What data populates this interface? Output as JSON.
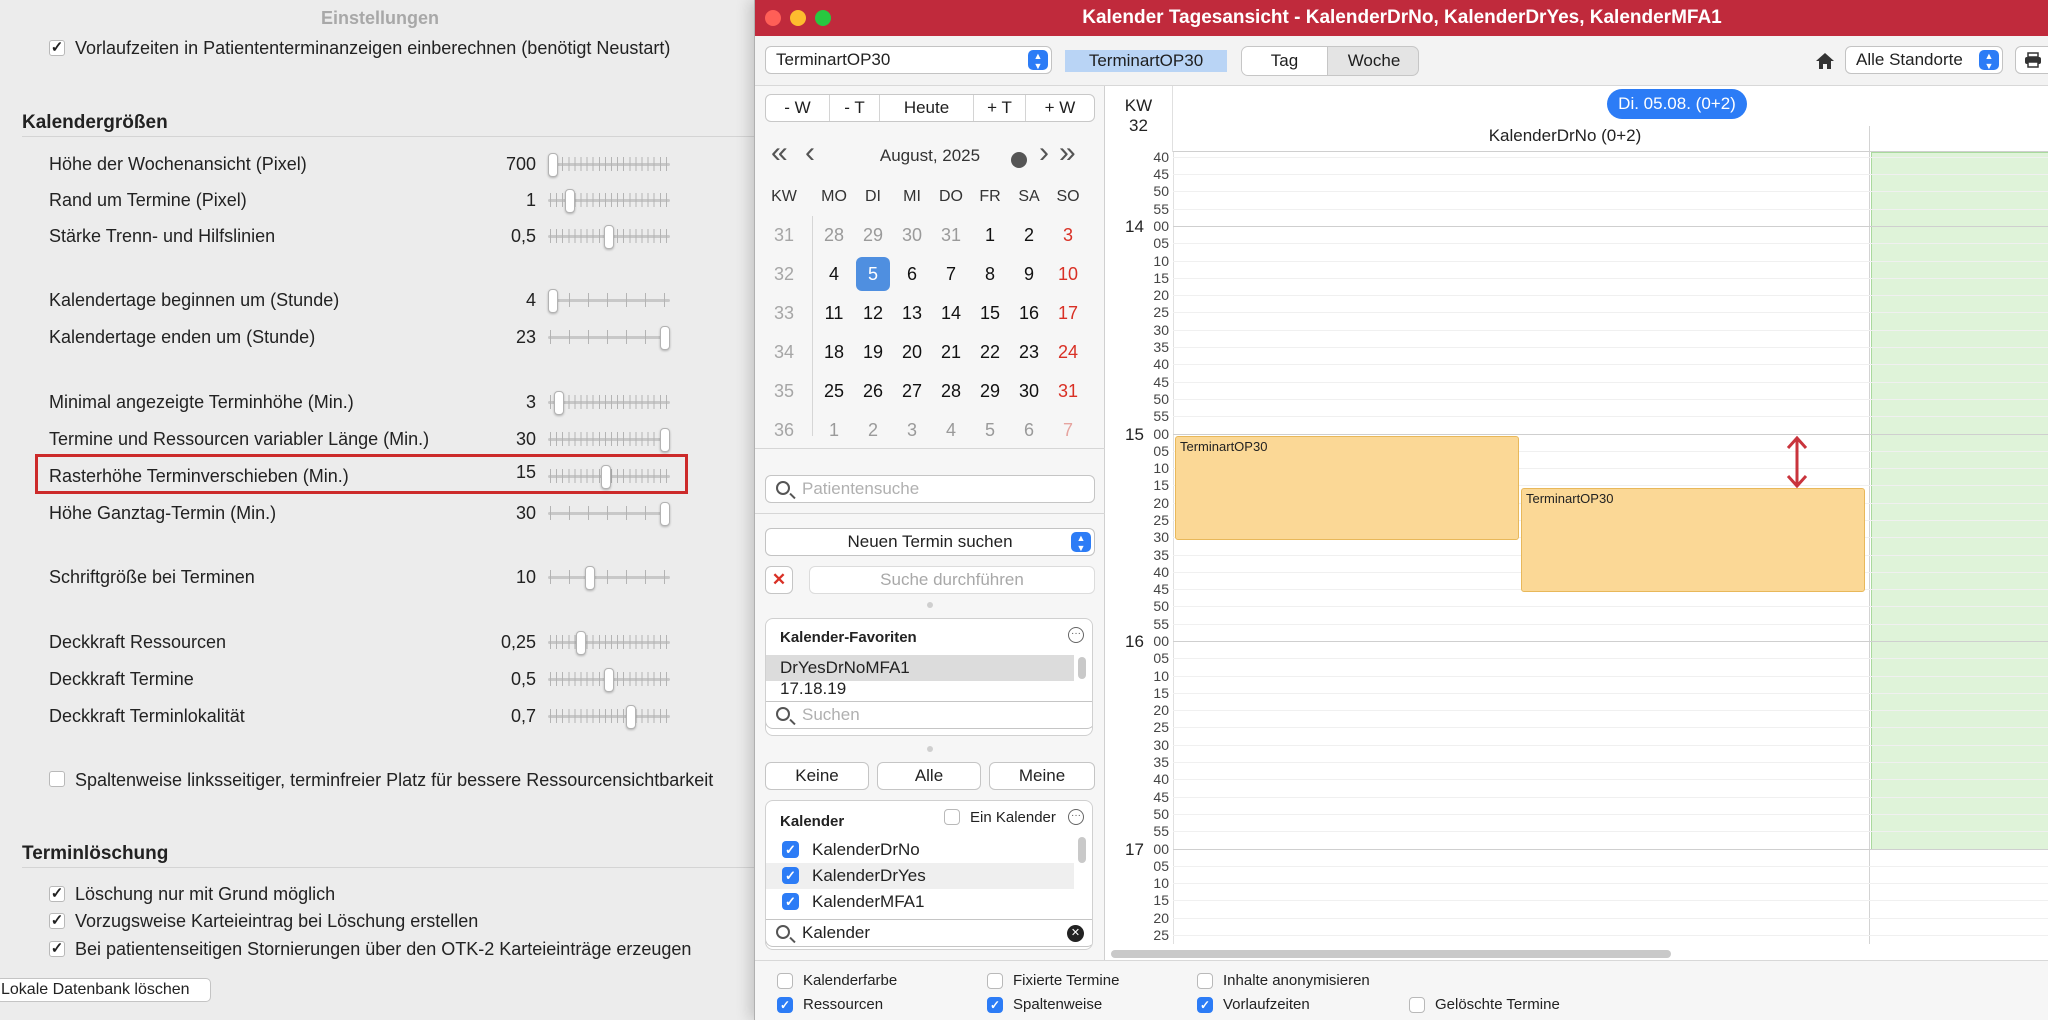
{
  "settings": {
    "window_title": "Einstellungen",
    "vorlauf_label": "Vorlaufzeiten in Patiententerminanzeigen einberechnen (benötigt Neustart)",
    "section_size": "Kalendergrößen",
    "section_delete": "Terminlöschung",
    "sliders": [
      {
        "label": "Höhe der Wochenansicht (Pixel)",
        "value": "700",
        "level": 0.0
      },
      {
        "label": "Rand um Termine (Pixel)",
        "value": "1",
        "level": 0.15
      },
      {
        "label": "Stärke Trenn- und Hilfslinien",
        "value": "0,5",
        "level": 0.5
      },
      {
        "label": "Kalendertage beginnen um (Stunde)",
        "value": "4",
        "level": 0.0
      },
      {
        "label": "Kalendertage enden um (Stunde)",
        "value": "23",
        "level": 1.0
      },
      {
        "label": "Minimal angezeigte Terminhöhe (Min.)",
        "value": "3",
        "level": 0.05
      },
      {
        "label": "Termine und Ressourcen variabler Länge (Min.)",
        "value": "30",
        "level": 1.0
      },
      {
        "label": "Rasterhöhe Terminverschieben (Min.)",
        "value": "15",
        "level": 0.47
      },
      {
        "label": "Höhe Ganztag-Termin (Min.)",
        "value": "30",
        "level": 1.0
      },
      {
        "label": "Schriftgröße bei Terminen",
        "value": "10",
        "level": 0.33
      },
      {
        "label": "Deckkraft Ressourcen",
        "value": "0,25",
        "level": 0.25
      },
      {
        "label": "Deckkraft Termine",
        "value": "0,5",
        "level": 0.5
      },
      {
        "label": "Deckkraft Terminlokalität",
        "value": "0,7",
        "level": 0.7
      }
    ],
    "spalten_label": "Spaltenweise linksseitiger, terminfreier Platz für bessere Ressourcensichtbarkeit",
    "delete_options": [
      "Löschung nur mit Grund möglich",
      "Vorzugsweise Karteieintrag bei Löschung erstellen",
      "Bei patientenseitigen Stornierungen über den OTK-2 Karteieinträge erzeugen"
    ],
    "delete_db_button": "Lokale Datenbank löschen"
  },
  "calendar": {
    "window_title": "Kalender Tagesansicht - KalenderDrNo, KalenderDrYes, KalenderMFA1",
    "appt_type_popup": "TerminartOP30",
    "appt_type_tag": "TerminartOP30",
    "view_day": "Tag",
    "view_week": "Woche",
    "location_popup": "Alle Standorte",
    "nav": [
      "- W",
      "- T",
      "Heute",
      "+ T",
      "+ W"
    ],
    "month_label": "August, 2025",
    "dow_headers": [
      "KW",
      "MO",
      "DI",
      "MI",
      "DO",
      "FR",
      "SA",
      "SO"
    ],
    "weeks": [
      {
        "kw": "31",
        "days": [
          "28",
          "29",
          "30",
          "31",
          "1",
          "2",
          "3"
        ]
      },
      {
        "kw": "32",
        "days": [
          "4",
          "5",
          "6",
          "7",
          "8",
          "9",
          "10"
        ]
      },
      {
        "kw": "33",
        "days": [
          "11",
          "12",
          "13",
          "14",
          "15",
          "16",
          "17"
        ]
      },
      {
        "kw": "34",
        "days": [
          "18",
          "19",
          "20",
          "21",
          "22",
          "23",
          "24"
        ]
      },
      {
        "kw": "35",
        "days": [
          "25",
          "26",
          "27",
          "28",
          "29",
          "30",
          "31"
        ]
      },
      {
        "kw": "36",
        "days": [
          "1",
          "2",
          "3",
          "4",
          "5",
          "6",
          "7"
        ]
      }
    ],
    "patient_search_placeholder": "Patientensuche",
    "search_mode_popup": "Neuen Termin suchen",
    "run_search_button": "Suche durchführen",
    "favorites": {
      "header": "Kalender-Favoriten",
      "items": [
        "DrYesDrNoMFA1",
        "17.18.19"
      ],
      "search_placeholder": "Suchen"
    },
    "filter_buttons": [
      "Keine",
      "Alle",
      "Meine"
    ],
    "calendars": {
      "header": "Kalender",
      "single_label": "Ein Kalender",
      "items": [
        "KalenderDrNo",
        "KalenderDrYes",
        "KalenderMFA1"
      ],
      "search_value": "Kalender"
    },
    "grid": {
      "kw_label": "KW",
      "kw_value": "32",
      "date_pill": "Di. 05.08. (0+2)",
      "column_header": "KalenderDrNo (0+2)",
      "hours": [
        "14",
        "15",
        "16",
        "17"
      ],
      "appointments": [
        "TerminartOP30",
        "TerminartOP30"
      ]
    },
    "options": [
      {
        "label": "Kalenderfarbe",
        "checked": false
      },
      {
        "label": "Fixierte Termine",
        "checked": false
      },
      {
        "label": "Inhalte anonymisieren",
        "checked": false
      },
      {
        "label": "Ressourcen",
        "checked": true
      },
      {
        "label": "Spaltenweise",
        "checked": true
      },
      {
        "label": "Vorlaufzeiten",
        "checked": true
      },
      {
        "label": "Gelöschte Termine",
        "checked": false
      }
    ]
  },
  "colors": {
    "titlebar": "#c02a3c",
    "accent": "#2c7cf6",
    "appointment": "#fbd896",
    "resource_block": "#dff3d9",
    "highlight": "#cc2a2a"
  }
}
